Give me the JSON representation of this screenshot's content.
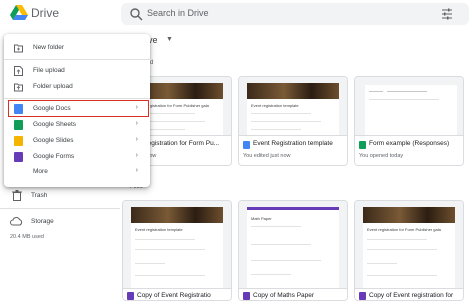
{
  "app": {
    "title": "Drive"
  },
  "search": {
    "placeholder": "Search in Drive"
  },
  "breadcrumb": {
    "label": "ve"
  },
  "sections": {
    "suggested_label": "d",
    "files_label": "Files"
  },
  "sidebar": {
    "trash_label": "Trash",
    "storage_label": "Storage",
    "storage_used": "20.4 MB used"
  },
  "menu": {
    "new_folder": "New folder",
    "file_upload": "File upload",
    "folder_upload": "Folder upload",
    "google_docs": "Google Docs",
    "google_sheets": "Google Sheets",
    "google_slides": "Google Slides",
    "google_forms": "Google Forms",
    "more": "More"
  },
  "suggested": [
    {
      "name": "Event registration for Form Pu...",
      "sub": "ent just now",
      "thumb_title": "Event registration for Form Publisher gala"
    },
    {
      "name": "Event Registration template",
      "sub": "You edited just now",
      "thumb_title": "Event registration template"
    },
    {
      "name": "Form example (Responses)",
      "sub": "You opened today"
    }
  ],
  "files": [
    {
      "name": "",
      "thumb_title": "Event registration template"
    },
    {
      "name": "Copy of Event Registratio",
      "thumb_title": "Event registration template"
    },
    {
      "name": "Copy of Maths Paper",
      "thumb_title": "Math Paper"
    },
    {
      "name": "Copy of Event registration for",
      "thumb_title": "Event registration for Form Publisher gala"
    }
  ],
  "colors": {
    "docs": "#4285f4",
    "sheets": "#0f9d58",
    "slides": "#f4b400",
    "forms": "#673ab7",
    "highlight": "#d93025"
  }
}
